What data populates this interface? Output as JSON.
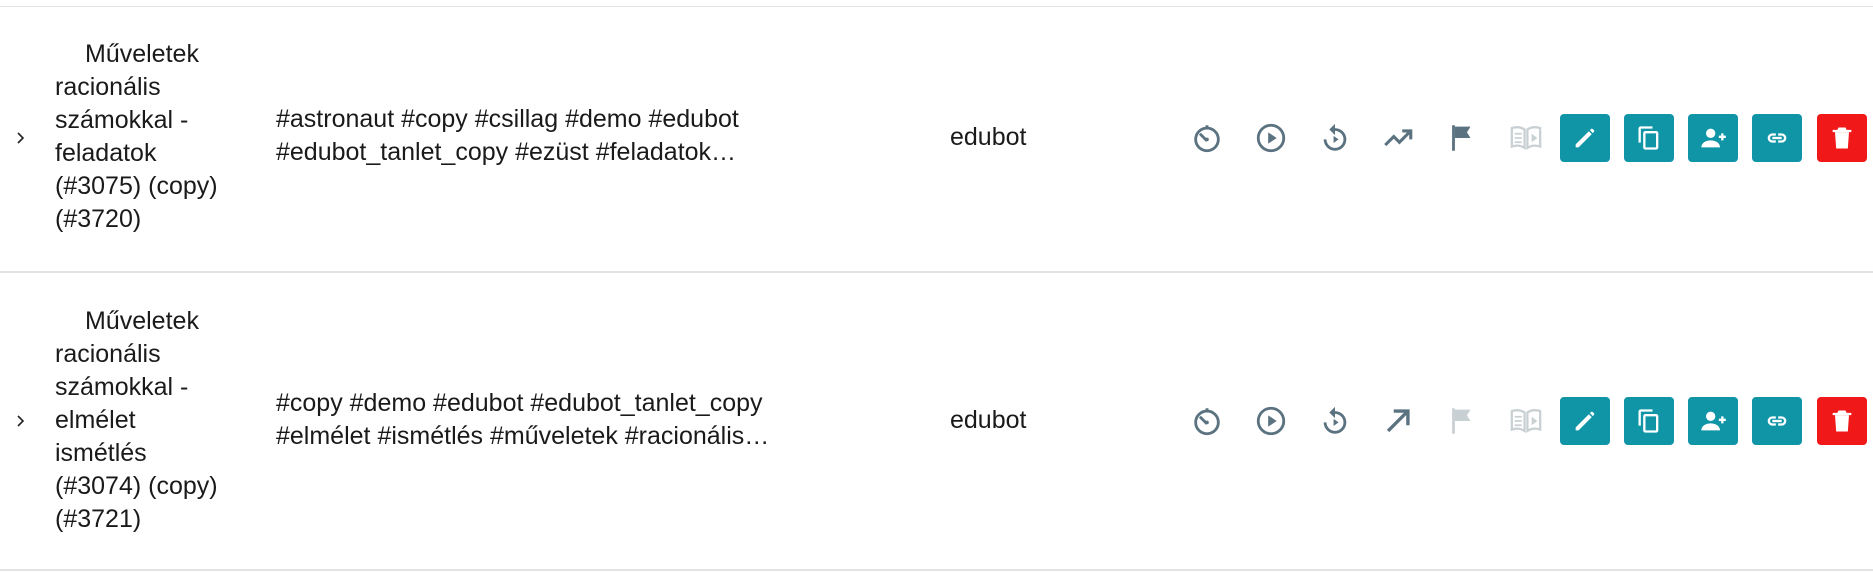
{
  "colors": {
    "icon_active": "#5b7380",
    "icon_disabled": "#c9d0d4",
    "button_teal": "#0f95a6",
    "button_red": "#f01818"
  },
  "rows": [
    {
      "title_lines": [
        "Műveletek",
        "racionális",
        "számokkal -",
        "feladatok",
        "(#3075) (copy)",
        "(#3720)"
      ],
      "tags_lines": [
        "#astronaut #copy #csillag #demo #edubot",
        "#edubot_tanlet_copy #ezüst #feladatok…"
      ],
      "owner": "edubot",
      "status_icons": [
        {
          "name": "timer-icon",
          "enabled": true
        },
        {
          "name": "play-circle-icon",
          "enabled": true
        },
        {
          "name": "replay-icon",
          "enabled": true
        },
        {
          "name": "trending-up-icon",
          "enabled": true
        },
        {
          "name": "flag-icon",
          "enabled": true
        },
        {
          "name": "book-play-icon",
          "enabled": false
        }
      ],
      "actions": [
        "edit-icon",
        "copy-icon",
        "add-user-icon",
        "link-icon",
        "delete-icon"
      ]
    },
    {
      "title_lines": [
        "Műveletek",
        "racionális",
        "számokkal -",
        "elmélet",
        "ismétlés",
        "(#3074) (copy)",
        "(#3721)"
      ],
      "tags_lines": [
        "#copy #demo #edubot #edubot_tanlet_copy",
        "#elmélet #ismétlés #műveletek #racionális…"
      ],
      "owner": "edubot",
      "status_icons": [
        {
          "name": "timer-icon",
          "enabled": true
        },
        {
          "name": "play-circle-icon",
          "enabled": true
        },
        {
          "name": "replay-icon",
          "enabled": true
        },
        {
          "name": "arrow-up-right-icon",
          "enabled": true
        },
        {
          "name": "flag-icon",
          "enabled": false
        },
        {
          "name": "book-play-icon",
          "enabled": false
        }
      ],
      "actions": [
        "edit-icon",
        "copy-icon",
        "add-user-icon",
        "link-icon",
        "delete-icon"
      ]
    }
  ]
}
